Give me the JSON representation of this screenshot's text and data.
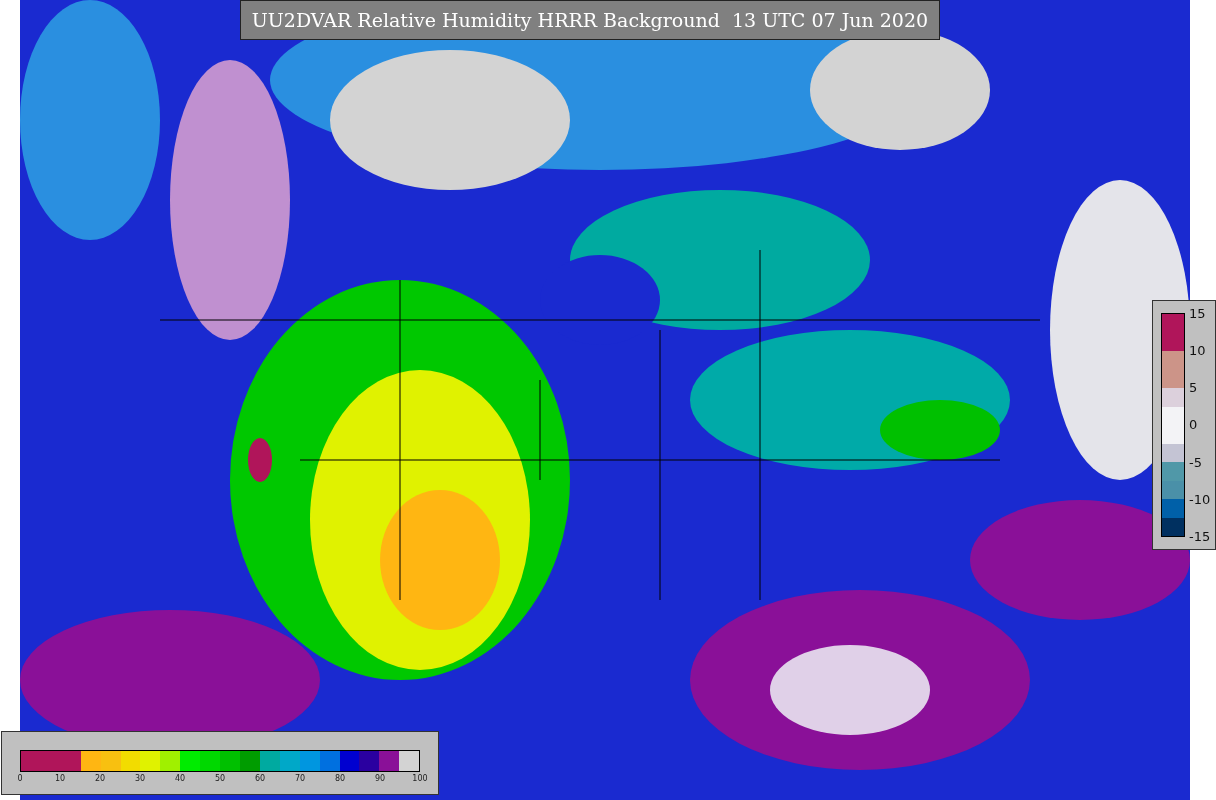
{
  "title": "UU2DVAR Relative Humidity HRRR Background  13 UTC 07 Jun 2020",
  "main_colorbar": {
    "segments": [
      {
        "color": "#b0155a"
      },
      {
        "color": "#b0155a"
      },
      {
        "color": "#b0155a"
      },
      {
        "color": "#ffb612"
      },
      {
        "color": "#f8c010"
      },
      {
        "color": "#f2dc00"
      },
      {
        "color": "#e0f200"
      },
      {
        "color": "#a0f000"
      },
      {
        "color": "#00ec00"
      },
      {
        "color": "#00d800"
      },
      {
        "color": "#00c000"
      },
      {
        "color": "#009c00"
      },
      {
        "color": "#00aaa0"
      },
      {
        "color": "#00a8c8"
      },
      {
        "color": "#0096e0"
      },
      {
        "color": "#0070e0"
      },
      {
        "color": "#0000d0"
      },
      {
        "color": "#2a00a0"
      },
      {
        "color": "#8a1098"
      },
      {
        "color": "#d3d3d3"
      }
    ],
    "ticks": [
      "0",
      "10",
      "20",
      "30",
      "40",
      "50",
      "60",
      "70",
      "80",
      "90",
      "100"
    ]
  },
  "diff_colorbar": {
    "segments": [
      {
        "color": "#b0155a"
      },
      {
        "color": "#b0155a"
      },
      {
        "color": "#cc9488"
      },
      {
        "color": "#cc9488"
      },
      {
        "color": "#dcd0dc"
      },
      {
        "color": "#f3f3f6"
      },
      {
        "color": "#f3f3f6"
      },
      {
        "color": "#c4c4d4"
      },
      {
        "color": "#5098a8"
      },
      {
        "color": "#4a90a8"
      },
      {
        "color": "#0060a8"
      },
      {
        "color": "#003060"
      }
    ],
    "ticks": [
      "15",
      "10",
      "5",
      "0",
      "-5",
      "-10",
      "-15"
    ]
  }
}
